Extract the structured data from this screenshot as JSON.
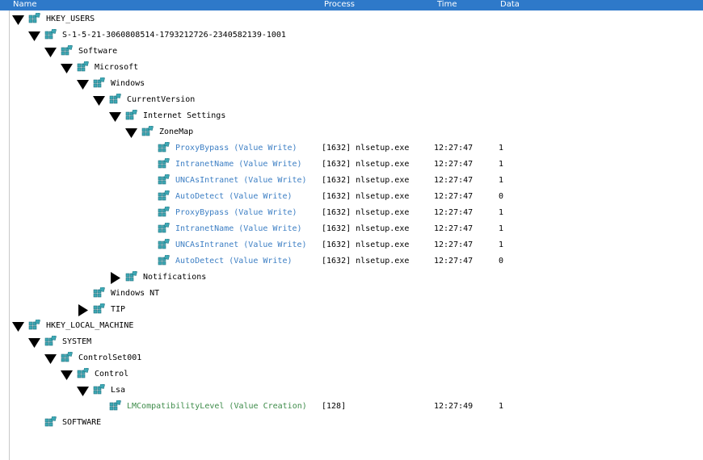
{
  "columns": {
    "name": "Name",
    "process": "Process",
    "time": "Time",
    "data": "Data"
  },
  "colors": {
    "header_bg": "#2e79c9",
    "value_write": "#3d7fc4",
    "value_creation": "#3e8c4a",
    "registry_icon": "#3ea9b5"
  },
  "rows": [
    {
      "label": "HKEY_USERS",
      "depth": 0,
      "toggle": "expanded",
      "kind": "key",
      "process": "",
      "time": "",
      "data": ""
    },
    {
      "label": "S-1-5-21-3060808514-1793212726-2340582139-1001",
      "depth": 1,
      "toggle": "expanded",
      "kind": "key",
      "process": "",
      "time": "",
      "data": ""
    },
    {
      "label": "Software",
      "depth": 2,
      "toggle": "expanded",
      "kind": "key",
      "process": "",
      "time": "",
      "data": ""
    },
    {
      "label": "Microsoft",
      "depth": 3,
      "toggle": "expanded",
      "kind": "key",
      "process": "",
      "time": "",
      "data": ""
    },
    {
      "label": "Windows",
      "depth": 4,
      "toggle": "expanded",
      "kind": "key",
      "process": "",
      "time": "",
      "data": ""
    },
    {
      "label": "CurrentVersion",
      "depth": 5,
      "toggle": "expanded",
      "kind": "key",
      "process": "",
      "time": "",
      "data": ""
    },
    {
      "label": "Internet Settings",
      "depth": 6,
      "toggle": "expanded",
      "kind": "key",
      "process": "",
      "time": "",
      "data": ""
    },
    {
      "label": "ZoneMap",
      "depth": 7,
      "toggle": "expanded",
      "kind": "key",
      "process": "",
      "time": "",
      "data": ""
    },
    {
      "label": "ProxyBypass (Value Write)",
      "depth": 8,
      "toggle": "none",
      "kind": "value-write",
      "process": "[1632] nlsetup.exe",
      "time": "12:27:47",
      "data": "1"
    },
    {
      "label": "IntranetName (Value Write)",
      "depth": 8,
      "toggle": "none",
      "kind": "value-write",
      "process": "[1632] nlsetup.exe",
      "time": "12:27:47",
      "data": "1"
    },
    {
      "label": "UNCAsIntranet (Value Write)",
      "depth": 8,
      "toggle": "none",
      "kind": "value-write",
      "process": "[1632] nlsetup.exe",
      "time": "12:27:47",
      "data": "1"
    },
    {
      "label": "AutoDetect (Value Write)",
      "depth": 8,
      "toggle": "none",
      "kind": "value-write",
      "process": "[1632] nlsetup.exe",
      "time": "12:27:47",
      "data": "0"
    },
    {
      "label": "ProxyBypass (Value Write)",
      "depth": 8,
      "toggle": "none",
      "kind": "value-write",
      "process": "[1632] nlsetup.exe",
      "time": "12:27:47",
      "data": "1"
    },
    {
      "label": "IntranetName (Value Write)",
      "depth": 8,
      "toggle": "none",
      "kind": "value-write",
      "process": "[1632] nlsetup.exe",
      "time": "12:27:47",
      "data": "1"
    },
    {
      "label": "UNCAsIntranet (Value Write)",
      "depth": 8,
      "toggle": "none",
      "kind": "value-write",
      "process": "[1632] nlsetup.exe",
      "time": "12:27:47",
      "data": "1"
    },
    {
      "label": "AutoDetect (Value Write)",
      "depth": 8,
      "toggle": "none",
      "kind": "value-write",
      "process": "[1632] nlsetup.exe",
      "time": "12:27:47",
      "data": "0"
    },
    {
      "label": "Notifications",
      "depth": 6,
      "toggle": "collapsed",
      "kind": "key",
      "process": "",
      "time": "",
      "data": ""
    },
    {
      "label": "Windows NT",
      "depth": 4,
      "toggle": "none",
      "kind": "key",
      "process": "",
      "time": "",
      "data": ""
    },
    {
      "label": "TIP",
      "depth": 4,
      "toggle": "collapsed",
      "kind": "key",
      "process": "",
      "time": "",
      "data": ""
    },
    {
      "label": "HKEY_LOCAL_MACHINE",
      "depth": 0,
      "toggle": "expanded",
      "kind": "key",
      "process": "",
      "time": "",
      "data": ""
    },
    {
      "label": "SYSTEM",
      "depth": 1,
      "toggle": "expanded",
      "kind": "key",
      "process": "",
      "time": "",
      "data": ""
    },
    {
      "label": "ControlSet001",
      "depth": 2,
      "toggle": "expanded",
      "kind": "key",
      "process": "",
      "time": "",
      "data": ""
    },
    {
      "label": "Control",
      "depth": 3,
      "toggle": "expanded",
      "kind": "key",
      "process": "",
      "time": "",
      "data": ""
    },
    {
      "label": "Lsa",
      "depth": 4,
      "toggle": "expanded",
      "kind": "key",
      "process": "",
      "time": "",
      "data": ""
    },
    {
      "label": "LMCompatibilityLevel (Value Creation)",
      "depth": 5,
      "toggle": "none",
      "kind": "value-create",
      "process": "[128]",
      "time": "12:27:49",
      "data": "1"
    },
    {
      "label": "SOFTWARE",
      "depth": 1,
      "toggle": "none",
      "kind": "key",
      "process": "",
      "time": "",
      "data": ""
    }
  ]
}
